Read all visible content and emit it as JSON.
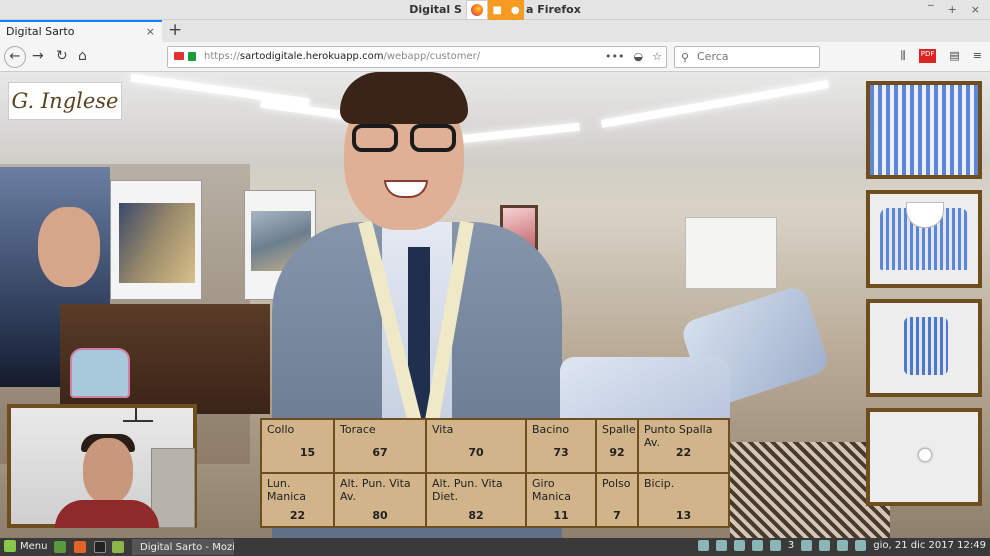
{
  "window": {
    "title": "Digital Sarto - Mozilla Firefox",
    "title_visible": "Digital S",
    "title_tail": "a Firefox"
  },
  "tabs": [
    {
      "label": "Digital Sarto"
    }
  ],
  "address_bar": {
    "url_prefix": "https://",
    "url_host": "sartodigitale.herokuapp.com",
    "url_path": "/webapp/customer/"
  },
  "search": {
    "placeholder": "Cerca"
  },
  "brand": {
    "logo_text": "G. Inglese"
  },
  "measurements": [
    {
      "label": "Collo",
      "value": "15"
    },
    {
      "label": "Torace",
      "value": "67"
    },
    {
      "label": "Vita",
      "value": "70"
    },
    {
      "label": "Bacino",
      "value": "73"
    },
    {
      "label": "Spalle",
      "value": "92"
    },
    {
      "label": "Punto Spalla Av.",
      "value": "22"
    },
    {
      "label": "Lun. Manica",
      "value": "22"
    },
    {
      "label": "Alt. Pun. Vita Av.",
      "value": "80"
    },
    {
      "label": "Alt. Pun. Vita Diet.",
      "value": "82"
    },
    {
      "label": "Giro Manica",
      "value": "11"
    },
    {
      "label": "Polso",
      "value": "7"
    },
    {
      "label": "Bicip.",
      "value": "13"
    }
  ],
  "taskbar": {
    "menu_label": "Menu",
    "firefox_task_label": "Digital Sarto - Mozill...",
    "updates_count": "3",
    "clock": "gio, 21 dic 2017 12:49"
  },
  "colors": {
    "frame": "#6e4d1e",
    "table_bg": "#d2b48a",
    "accent_tab": "#0a84ff"
  }
}
